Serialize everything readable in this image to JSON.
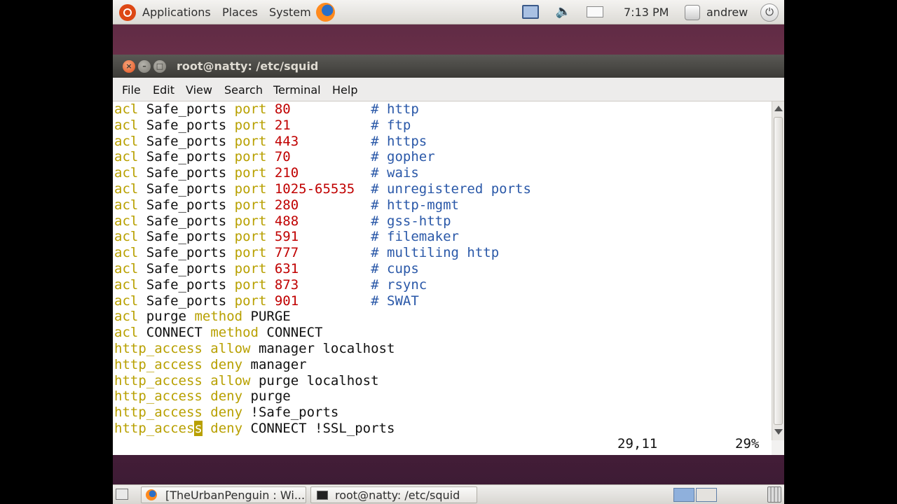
{
  "top_panel": {
    "menus": [
      "Applications",
      "Places",
      "System"
    ],
    "clock": "7:13 PM",
    "user": "andrew"
  },
  "window": {
    "title": "root@natty: /etc/squid",
    "menus": [
      "File",
      "Edit",
      "View",
      "Search",
      "Terminal",
      "Help"
    ]
  },
  "terminal": {
    "safe_ports": [
      {
        "kw": "acl",
        "name": "Safe_ports",
        "port_kw": "port",
        "port": "80",
        "comment": "# http"
      },
      {
        "kw": "acl",
        "name": "Safe_ports",
        "port_kw": "port",
        "port": "21",
        "comment": "# ftp"
      },
      {
        "kw": "acl",
        "name": "Safe_ports",
        "port_kw": "port",
        "port": "443",
        "comment": "# https"
      },
      {
        "kw": "acl",
        "name": "Safe_ports",
        "port_kw": "port",
        "port": "70",
        "comment": "# gopher"
      },
      {
        "kw": "acl",
        "name": "Safe_ports",
        "port_kw": "port",
        "port": "210",
        "comment": "# wais"
      },
      {
        "kw": "acl",
        "name": "Safe_ports",
        "port_kw": "port",
        "port": "1025-65535",
        "comment": "# unregistered ports"
      },
      {
        "kw": "acl",
        "name": "Safe_ports",
        "port_kw": "port",
        "port": "280",
        "comment": "# http-mgmt"
      },
      {
        "kw": "acl",
        "name": "Safe_ports",
        "port_kw": "port",
        "port": "488",
        "comment": "# gss-http"
      },
      {
        "kw": "acl",
        "name": "Safe_ports",
        "port_kw": "port",
        "port": "591",
        "comment": "# filemaker"
      },
      {
        "kw": "acl",
        "name": "Safe_ports",
        "port_kw": "port",
        "port": "777",
        "comment": "# multiling http"
      },
      {
        "kw": "acl",
        "name": "Safe_ports",
        "port_kw": "port",
        "port": "631",
        "comment": "# cups"
      },
      {
        "kw": "acl",
        "name": "Safe_ports",
        "port_kw": "port",
        "port": "873",
        "comment": "# rsync"
      },
      {
        "kw": "acl",
        "name": "Safe_ports",
        "port_kw": "port",
        "port": "901",
        "comment": "# SWAT"
      }
    ],
    "method_lines": [
      {
        "kw": "acl",
        "name": "purge",
        "method_kw": "method",
        "value": "PURGE"
      },
      {
        "kw": "acl",
        "name": "CONNECT",
        "method_kw": "method",
        "value": "CONNECT"
      }
    ],
    "access_lines": [
      {
        "kw": "http_access",
        "action": "allow",
        "rest": "manager localhost"
      },
      {
        "kw": "http_access",
        "action": "deny",
        "rest": "manager"
      },
      {
        "kw": "http_access",
        "action": "allow",
        "rest": "purge localhost"
      },
      {
        "kw": "http_access",
        "action": "deny",
        "rest": "purge"
      },
      {
        "kw": "http_access",
        "action": "deny",
        "rest": "!Safe_ports"
      }
    ],
    "cursor_line": {
      "kw_before": "http_acces",
      "cursor_char": "s",
      "action": "deny",
      "rest": "CONNECT !SSL_ports"
    },
    "status_position": "29,11",
    "status_percent": "29%"
  },
  "bottom_panel": {
    "tasks": [
      "[TheUrbanPenguin : Wi...",
      "root@natty: /etc/squid"
    ]
  },
  "colors": {
    "keyword": "#b8a000",
    "number": "#c00000",
    "comment": "#2a58a8"
  }
}
